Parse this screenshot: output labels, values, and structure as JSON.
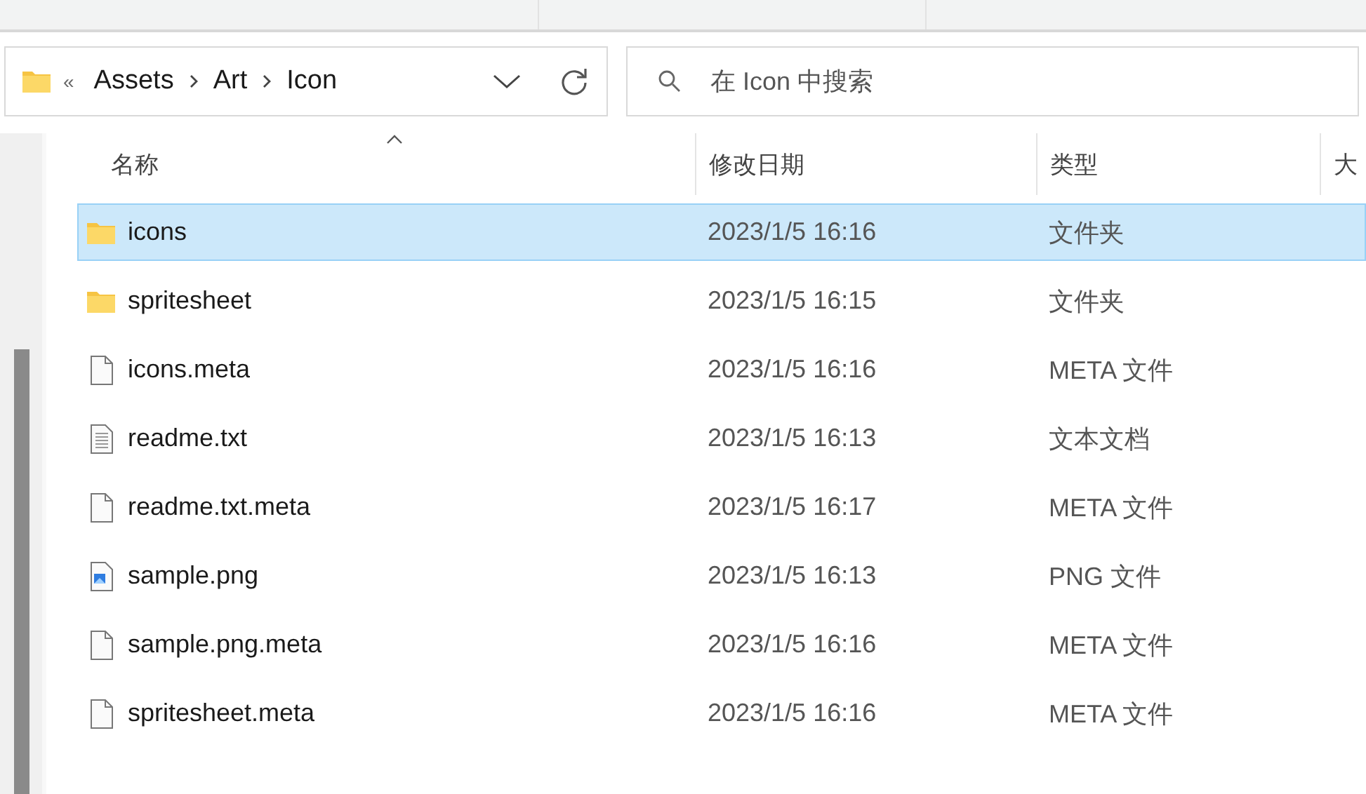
{
  "breadcrumb": {
    "overflow": "«",
    "items": [
      "Assets",
      "Art",
      "Icon"
    ]
  },
  "search": {
    "placeholder": "在 Icon 中搜索"
  },
  "columns": [
    {
      "label": "名称",
      "sorted": true
    },
    {
      "label": "修改日期",
      "sorted": false
    },
    {
      "label": "类型",
      "sorted": false
    },
    {
      "label": "大",
      "sorted": false
    }
  ],
  "rows": [
    {
      "name": "icons",
      "kind": "folder",
      "date": "2023/1/5 16:16",
      "type": "文件夹",
      "selected": true
    },
    {
      "name": "spritesheet",
      "kind": "folder",
      "date": "2023/1/5 16:15",
      "type": "文件夹",
      "selected": false
    },
    {
      "name": "icons.meta",
      "kind": "file",
      "date": "2023/1/5 16:16",
      "type": "META 文件",
      "selected": false
    },
    {
      "name": "readme.txt",
      "kind": "text",
      "date": "2023/1/5 16:13",
      "type": "文本文档",
      "selected": false
    },
    {
      "name": "readme.txt.meta",
      "kind": "file",
      "date": "2023/1/5 16:17",
      "type": "META 文件",
      "selected": false
    },
    {
      "name": "sample.png",
      "kind": "image",
      "date": "2023/1/5 16:13",
      "type": "PNG 文件",
      "selected": false
    },
    {
      "name": "sample.png.meta",
      "kind": "file",
      "date": "2023/1/5 16:16",
      "type": "META 文件",
      "selected": false
    },
    {
      "name": "spritesheet.meta",
      "kind": "file",
      "date": "2023/1/5 16:16",
      "type": "META 文件",
      "selected": false
    }
  ]
}
